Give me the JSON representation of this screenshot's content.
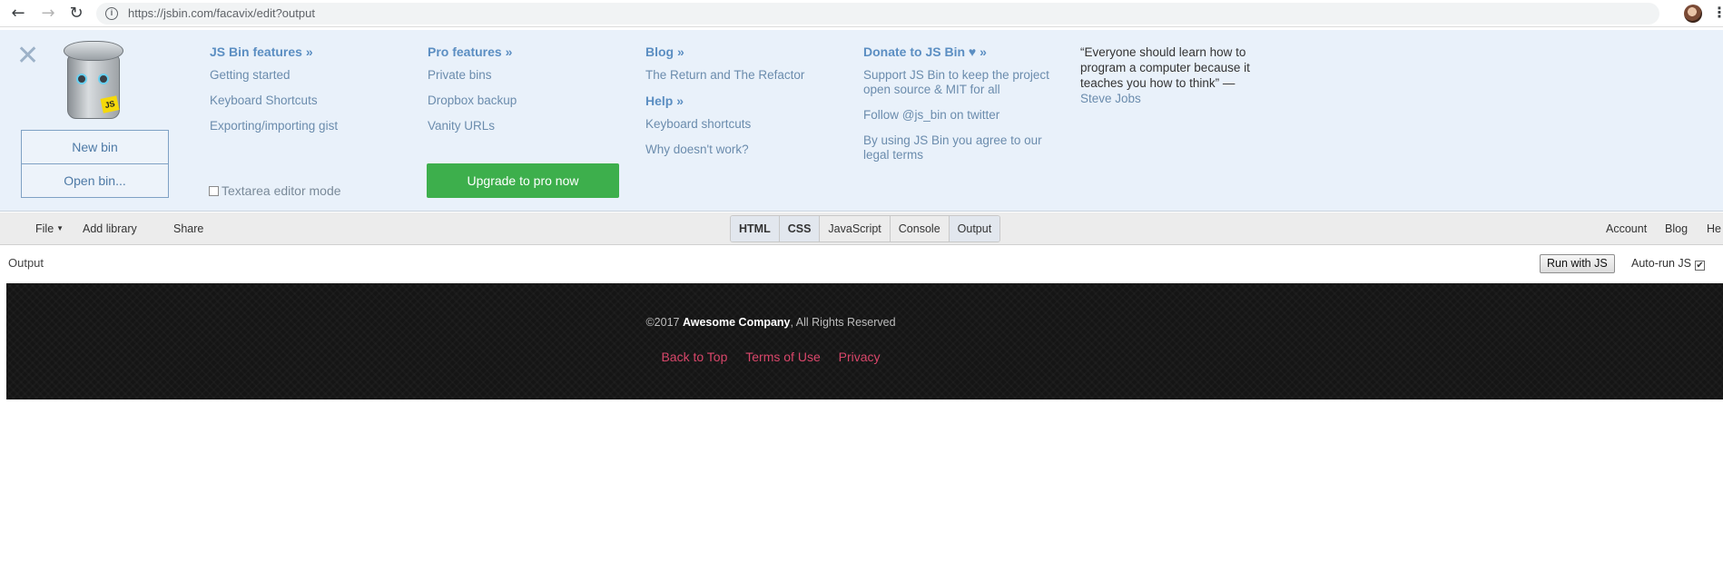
{
  "browser": {
    "url": "https://jsbin.com/facavix/edit?output"
  },
  "panel": {
    "buttons": {
      "new_bin": "New bin",
      "open_bin": "Open bin..."
    },
    "col1": {
      "head": "JS Bin features »",
      "links": [
        "Getting started",
        "Keyboard Shortcuts",
        "Exporting/importing gist"
      ],
      "textarea_mode": "Textarea editor mode"
    },
    "col2": {
      "head": "Pro features »",
      "links": [
        "Private bins",
        "Dropbox backup",
        "Vanity URLs"
      ],
      "upgrade": "Upgrade to pro now"
    },
    "col3": {
      "head": "Blog »",
      "links": [
        "The Return and The Refactor"
      ],
      "help_head": "Help »",
      "help_links": [
        "Keyboard shortcuts",
        "Why doesn't work?"
      ]
    },
    "col4": {
      "head": "Donate to JS Bin",
      "heart": "♥",
      "raquo": "»",
      "links": [
        "Support JS Bin to keep the project open source & MIT for all",
        "Follow @js_bin on twitter",
        "By using JS Bin you agree to our legal terms"
      ]
    },
    "quote": {
      "text": "“Everyone should learn how to program a computer because it teaches you how to think” —",
      "author": "Steve Jobs"
    }
  },
  "toolbar": {
    "file": "File",
    "add_library": "Add library",
    "share": "Share",
    "tabs": [
      "HTML",
      "CSS",
      "JavaScript",
      "Console",
      "Output"
    ],
    "account": "Account",
    "blog": "Blog",
    "help": "He"
  },
  "output": {
    "label": "Output",
    "run_btn": "Run with JS",
    "autorun": "Auto-run JS"
  },
  "footer": {
    "copyright_prefix": "©2017 ",
    "company": "Awesome Company",
    "copyright_suffix": ", All Rights Reserved",
    "links": [
      "Back to Top",
      "Terms of Use",
      "Privacy"
    ]
  },
  "colors": {
    "panel_bg": "#e9f1fa",
    "link": "#6b8cad",
    "heading": "#5b8ec2",
    "upgrade_green": "#3daf4c",
    "footer_link": "#d8466a"
  }
}
